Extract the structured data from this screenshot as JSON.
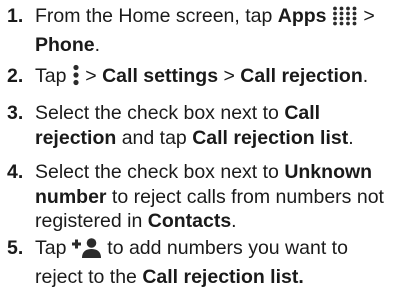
{
  "steps": [
    {
      "number": "1.",
      "parts": {
        "a": "From the Home screen, tap ",
        "b": "Apps",
        "c": " > ",
        "d": "Phone",
        "e": "."
      },
      "icon": "apps-grid-icon"
    },
    {
      "number": "2.",
      "parts": {
        "a": "Tap ",
        "b": " > ",
        "c": "Call settings",
        "d": " > ",
        "e": "Call rejection",
        "f": "."
      },
      "icon": "more-options-icon"
    },
    {
      "number": "3.",
      "parts": {
        "a": "Select the check box next to ",
        "b": "Call rejection",
        "c": " and tap ",
        "d": "Call rejection list",
        "e": "."
      }
    },
    {
      "number": "4.",
      "parts": {
        "a": "Select the check box next to ",
        "b": "Unknown number",
        "c": " to reject calls from numbers not registered in ",
        "d": "Contacts",
        "e": "."
      }
    },
    {
      "number": "5.",
      "parts": {
        "a": "Tap ",
        "b": " to add numbers you want to reject to the ",
        "c": "Call rejection list."
      },
      "icon": "add-contact-icon"
    }
  ],
  "colors": {
    "text": "#1a1a1a",
    "icon": "#2b2b2b"
  }
}
